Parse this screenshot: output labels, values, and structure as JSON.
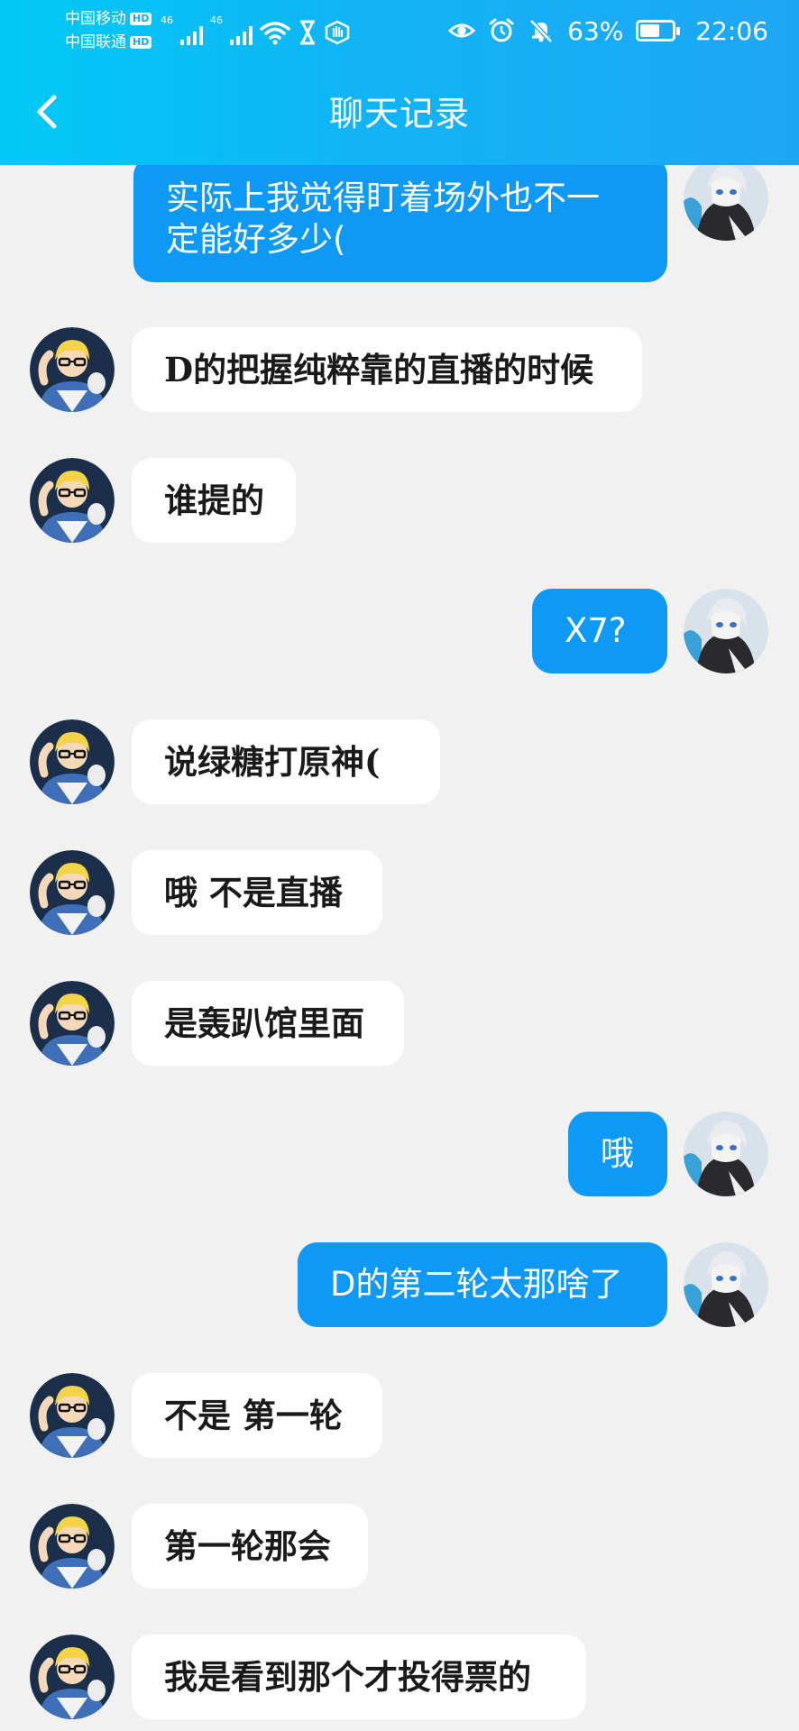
{
  "status_bar": {
    "carrier_1": "中国移动",
    "carrier_2": "中国联通",
    "hd_label": "HD",
    "network_1": "46",
    "network_2": "46",
    "battery_percent": "63%",
    "battery_level": 0.63,
    "time": "22:06",
    "icons": [
      "signal-icon",
      "wifi-icon",
      "hourglass-icon",
      "hand-icon",
      "eye-icon",
      "alarm-icon",
      "mute-icon",
      "battery-icon"
    ]
  },
  "header": {
    "title": "聊天记录",
    "back_icon": "chevron-left-icon",
    "color_start": "#00c9f6",
    "color_end": "#1ea6f4"
  },
  "colors": {
    "background": "#f1f1f1",
    "outgoing_bubble": "#0e99f6",
    "incoming_bubble": "#ffffff"
  },
  "messages": [
    {
      "side": "out",
      "lines": [
        "实际上我觉得盯着场外也不一",
        "定能好多少("
      ]
    },
    {
      "side": "in",
      "lines": [
        "D的把握纯粹靠的直播的时候"
      ]
    },
    {
      "side": "in",
      "lines": [
        "谁提的"
      ]
    },
    {
      "side": "out",
      "lines": [
        "X7?"
      ]
    },
    {
      "side": "in",
      "lines": [
        "说绿糖打原神("
      ]
    },
    {
      "side": "in",
      "lines": [
        "哦 不是直播"
      ]
    },
    {
      "side": "in",
      "lines": [
        "是轰趴馆里面"
      ]
    },
    {
      "side": "out",
      "lines": [
        "哦"
      ]
    },
    {
      "side": "out",
      "lines": [
        "D的第二轮太那啥了"
      ]
    },
    {
      "side": "in",
      "lines": [
        "不是 第一轮"
      ]
    },
    {
      "side": "in",
      "lines": [
        "第一轮那会"
      ]
    },
    {
      "side": "in",
      "lines": [
        "我是看到那个才投得票的"
      ]
    }
  ]
}
